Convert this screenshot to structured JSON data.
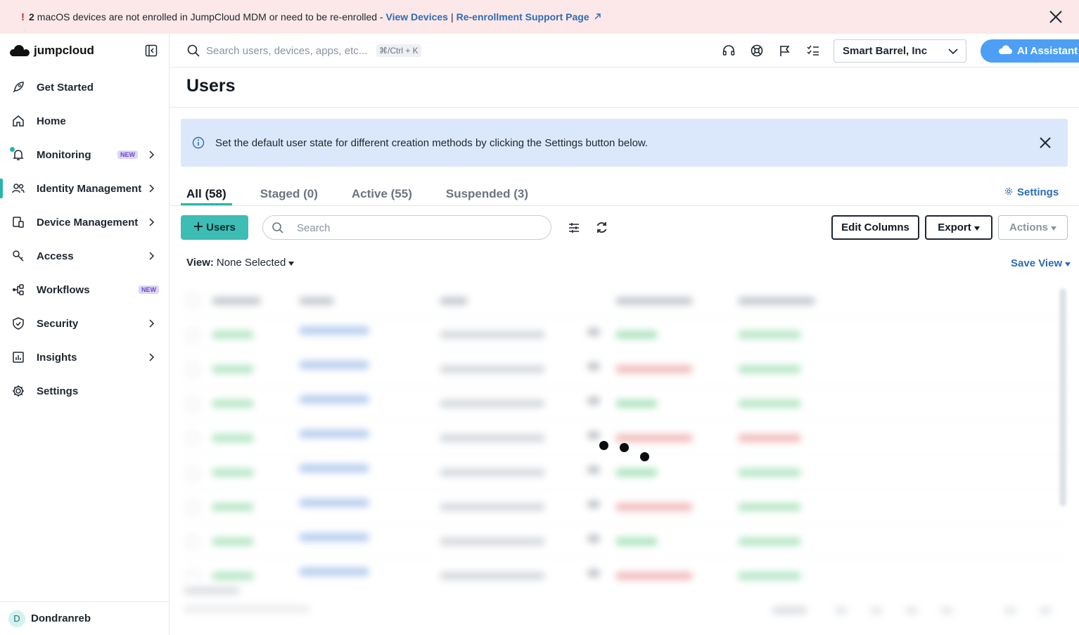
{
  "banner": {
    "count": "2",
    "message": "macOS devices are not enrolled in JumpCloud MDM or need to be re-enrolled -",
    "link_view_devices": "View Devices",
    "separator": "|",
    "link_reenroll": "Re-enrollment Support Page"
  },
  "sidebar": {
    "logo_text": "jumpcloud",
    "items": [
      {
        "label": "Get Started",
        "icon": "rocket-icon"
      },
      {
        "label": "Home",
        "icon": "home-icon"
      },
      {
        "label": "Monitoring",
        "icon": "bell-icon",
        "badge": "NEW"
      },
      {
        "label": "Identity Management",
        "icon": "users-icon"
      },
      {
        "label": "Device Management",
        "icon": "devices-icon"
      },
      {
        "label": "Access",
        "icon": "key-icon"
      },
      {
        "label": "Workflows",
        "icon": "workflow-icon",
        "badge": "NEW"
      },
      {
        "label": "Security",
        "icon": "shield-icon"
      },
      {
        "label": "Insights",
        "icon": "chart-icon"
      },
      {
        "label": "Settings",
        "icon": "gear-icon"
      }
    ],
    "user": {
      "initial": "D",
      "name": "Dondranreb"
    }
  },
  "topbar": {
    "search_placeholder": "Search users, devices, apps, etc...",
    "shortcut": "⌘/Ctrl + K",
    "org_name": "Smart Barrel, Inc",
    "ai_label": "AI Assistant"
  },
  "main": {
    "title": "Users",
    "info_text": "Set the default user state for different creation methods by clicking the Settings button below.",
    "tabs": [
      {
        "label": "All (58)"
      },
      {
        "label": "Staged (0)"
      },
      {
        "label": "Active (55)"
      },
      {
        "label": "Suspended (3)"
      }
    ],
    "settings_label": "Settings",
    "add_users_label": "Users",
    "search_placeholder": "Search",
    "edit_columns_label": "Edit Columns",
    "export_label": "Export",
    "actions_label": "Actions",
    "view_prefix": "View:",
    "view_value": "None Selected",
    "save_view_label": "Save View"
  },
  "colors": {
    "accent": "#27b5ad",
    "link": "#2d6cb3",
    "banner_bg": "#fce8e8",
    "info_bg": "#dbe8fb",
    "ai_button": "#4c9ff5"
  }
}
